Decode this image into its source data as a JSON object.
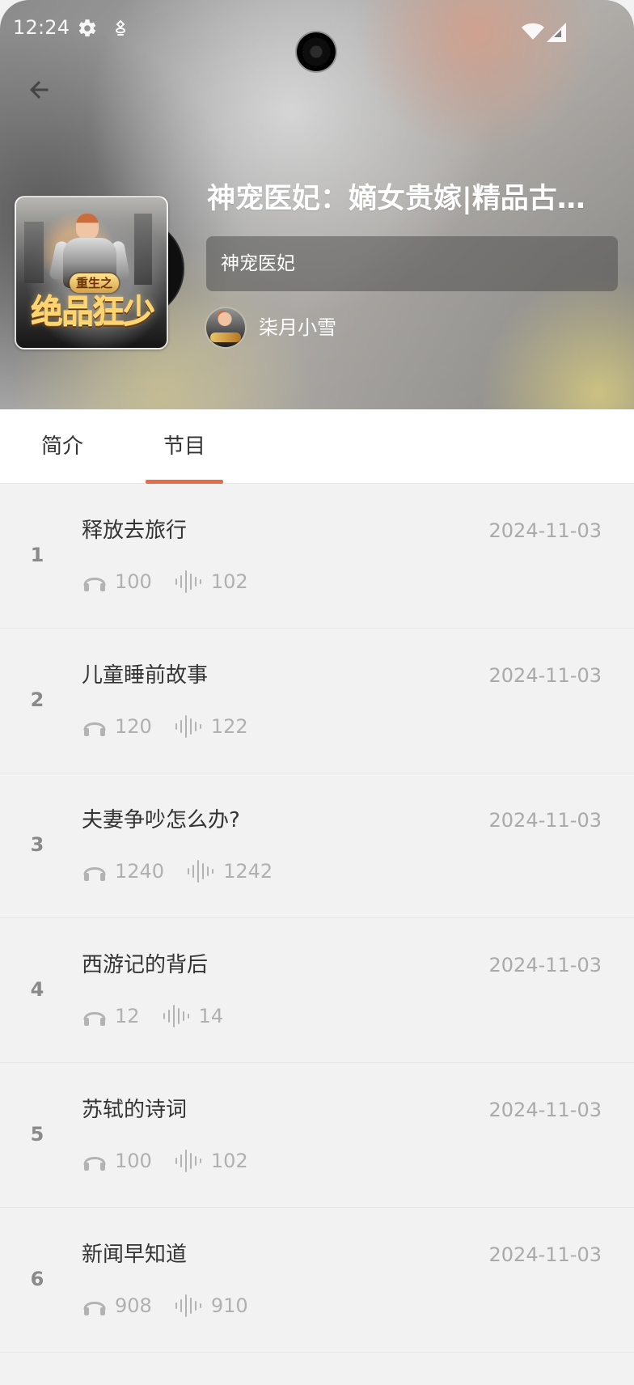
{
  "status_bar": {
    "time": "12:24",
    "settings_icon": "gear-icon",
    "small_icon": "notification-icon",
    "wifi_icon": "wifi-icon",
    "signal_icon": "signal-icon"
  },
  "header": {
    "back_icon": "back-arrow-icon",
    "title": "神宠医妃：嫡女贵嫁|精品古言|...",
    "subtitle": "神宠医妃",
    "author": "柒月小雪",
    "cover_badge": "重生之",
    "cover_title": "绝品狂少"
  },
  "tabs": [
    {
      "label": "简介",
      "active": false
    },
    {
      "label": "节目",
      "active": true
    }
  ],
  "episodes": [
    {
      "index": "1",
      "title": "释放去旅行",
      "date": "2024-11-03",
      "listens": "100",
      "plays": "102"
    },
    {
      "index": "2",
      "title": "儿童睡前故事",
      "date": "2024-11-03",
      "listens": "120",
      "plays": "122"
    },
    {
      "index": "3",
      "title": "夫妻争吵怎么办?",
      "date": "2024-11-03",
      "listens": "1240",
      "plays": "1242"
    },
    {
      "index": "4",
      "title": "西游记的背后",
      "date": "2024-11-03",
      "listens": "12",
      "plays": "14"
    },
    {
      "index": "5",
      "title": "苏轼的诗词",
      "date": "2024-11-03",
      "listens": "100",
      "plays": "102"
    },
    {
      "index": "6",
      "title": "新闻早知道",
      "date": "2024-11-03",
      "listens": "908",
      "plays": "910"
    }
  ],
  "colors": {
    "accent": "#e56b49",
    "background": "#f2f2f2",
    "text_primary": "#333333",
    "text_secondary": "#aaaaaa"
  }
}
